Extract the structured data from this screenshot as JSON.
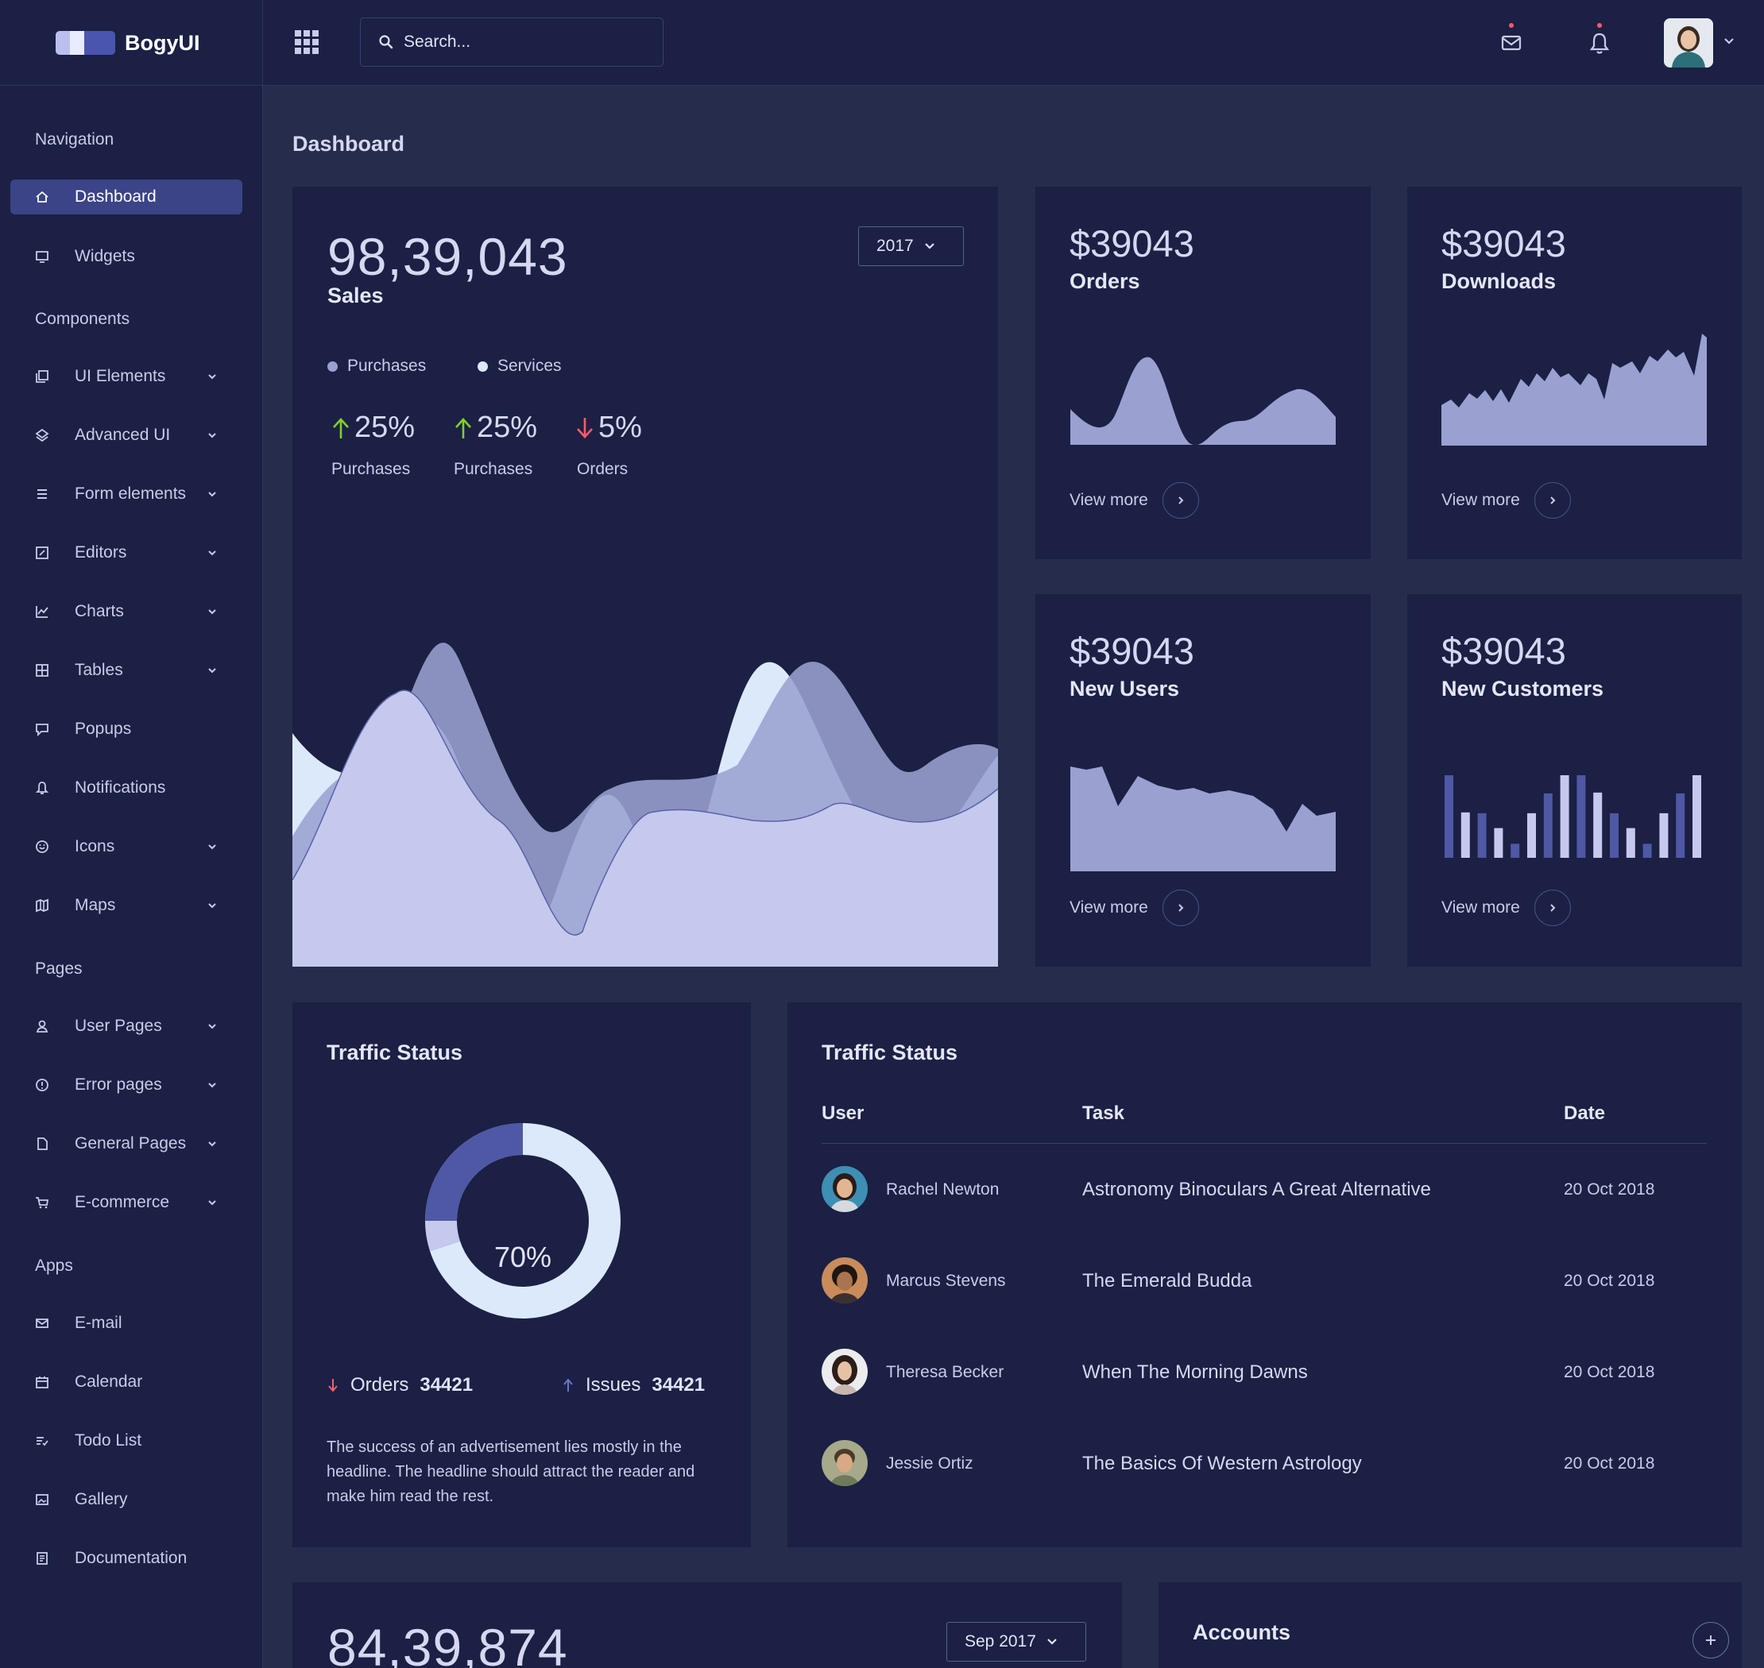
{
  "brand": {
    "name": "BogyUI"
  },
  "colors": {
    "background": "#262c4c",
    "panel": "#1b2044",
    "accent": "#3a4486",
    "chart_light": "#dbe9fb",
    "chart_mid": "#9aa0d0",
    "chart_fill": "#c5c9ee",
    "up": "#7ed321",
    "down": "#ff5b6b"
  },
  "header": {
    "search_placeholder": "Search...",
    "icons": [
      "apps-grid-icon",
      "search-icon",
      "mail-icon",
      "bell-icon",
      "chevron-down-icon"
    ]
  },
  "sidebar": {
    "sections": [
      {
        "label": "Navigation"
      },
      {
        "label": "Components"
      },
      {
        "label": "Pages"
      },
      {
        "label": "Apps"
      }
    ],
    "items": [
      {
        "label": "Dashboard",
        "icon": "home-icon",
        "active": true
      },
      {
        "label": "Widgets",
        "icon": "monitor-icon"
      },
      {
        "label": "UI Elements",
        "icon": "copy-icon"
      },
      {
        "label": "Advanced UI",
        "icon": "layers-icon"
      },
      {
        "label": "Form elements",
        "icon": "list-icon"
      },
      {
        "label": "Editors",
        "icon": "edit-icon"
      },
      {
        "label": "Charts",
        "icon": "line-chart-icon"
      },
      {
        "label": "Tables",
        "icon": "grid-icon"
      },
      {
        "label": "Popups",
        "icon": "message-icon"
      },
      {
        "label": "Notifications",
        "icon": "bell-icon"
      },
      {
        "label": "Icons",
        "icon": "smile-icon"
      },
      {
        "label": "Maps",
        "icon": "map-icon"
      },
      {
        "label": "User Pages",
        "icon": "user-icon"
      },
      {
        "label": "Error pages",
        "icon": "alert-icon"
      },
      {
        "label": "General Pages",
        "icon": "file-icon"
      },
      {
        "label": "E-commerce",
        "icon": "cart-icon"
      },
      {
        "label": "E-mail",
        "icon": "mail-icon"
      },
      {
        "label": "Calendar",
        "icon": "calendar-icon"
      },
      {
        "label": "Todo List",
        "icon": "todo-icon"
      },
      {
        "label": "Gallery",
        "icon": "image-icon"
      },
      {
        "label": "Documentation",
        "icon": "document-icon"
      }
    ]
  },
  "main": {
    "title": "Dashboard",
    "sales": {
      "value": "98,39,043",
      "label": "Sales",
      "year": "2017",
      "legend": [
        "Purchases",
        "Services"
      ],
      "stats": [
        {
          "value": "25%",
          "label": "Purchases",
          "trend": "up"
        },
        {
          "value": "25%",
          "label": "Purchases",
          "trend": "up"
        },
        {
          "value": "5%",
          "label": "Orders",
          "trend": "down"
        }
      ]
    },
    "small_cards": [
      {
        "value": "$39043",
        "label": "Orders",
        "link": "View more"
      },
      {
        "value": "$39043",
        "label": "Downloads",
        "link": "View more"
      },
      {
        "value": "$39043",
        "label": "New Users",
        "link": "View more"
      },
      {
        "value": "$39043",
        "label": "New Customers",
        "link": "View more"
      }
    ],
    "traffic": {
      "title": "Traffic Status",
      "percent": "70%",
      "orders_label": "Orders",
      "orders_value": "34421",
      "issues_label": "Issues",
      "issues_value": "34421",
      "description": "The success of an advertisement lies mostly in the headline. The headline should attract the reader and make him read the rest."
    },
    "traffic_table": {
      "title": "Traffic Status",
      "headers": [
        "User",
        "Task",
        "Date"
      ],
      "rows": [
        {
          "user": "Rachel Newton",
          "task": "Astronomy Binoculars A Great Alternative",
          "date": "20 Oct 2018"
        },
        {
          "user": "Marcus Stevens",
          "task": "The Emerald Budda",
          "date": "20 Oct 2018"
        },
        {
          "user": "Theresa Becker",
          "task": "When The Morning Dawns",
          "date": "20 Oct 2018"
        },
        {
          "user": "Jessie Ortiz",
          "task": "The Basics Of Western Astrology",
          "date": "20 Oct 2018"
        }
      ]
    },
    "second_value": {
      "value": "84,39,874",
      "month": "Sep 2017"
    },
    "accounts": {
      "title": "Accounts"
    }
  },
  "chart_data": [
    {
      "type": "area",
      "series": [
        {
          "name": "Purchases"
        },
        {
          "name": "Services"
        }
      ]
    },
    {
      "type": "area"
    },
    {
      "type": "area"
    },
    {
      "type": "area"
    },
    {
      "type": "bar",
      "values": [
        10,
        5.5,
        5.4,
        3.6,
        1.7,
        5.4,
        7.8,
        10,
        10,
        7.9,
        5.4,
        3.6,
        1.7,
        5.4,
        7.8,
        10
      ]
    },
    {
      "type": "pie",
      "values": [
        70,
        30
      ]
    }
  ]
}
